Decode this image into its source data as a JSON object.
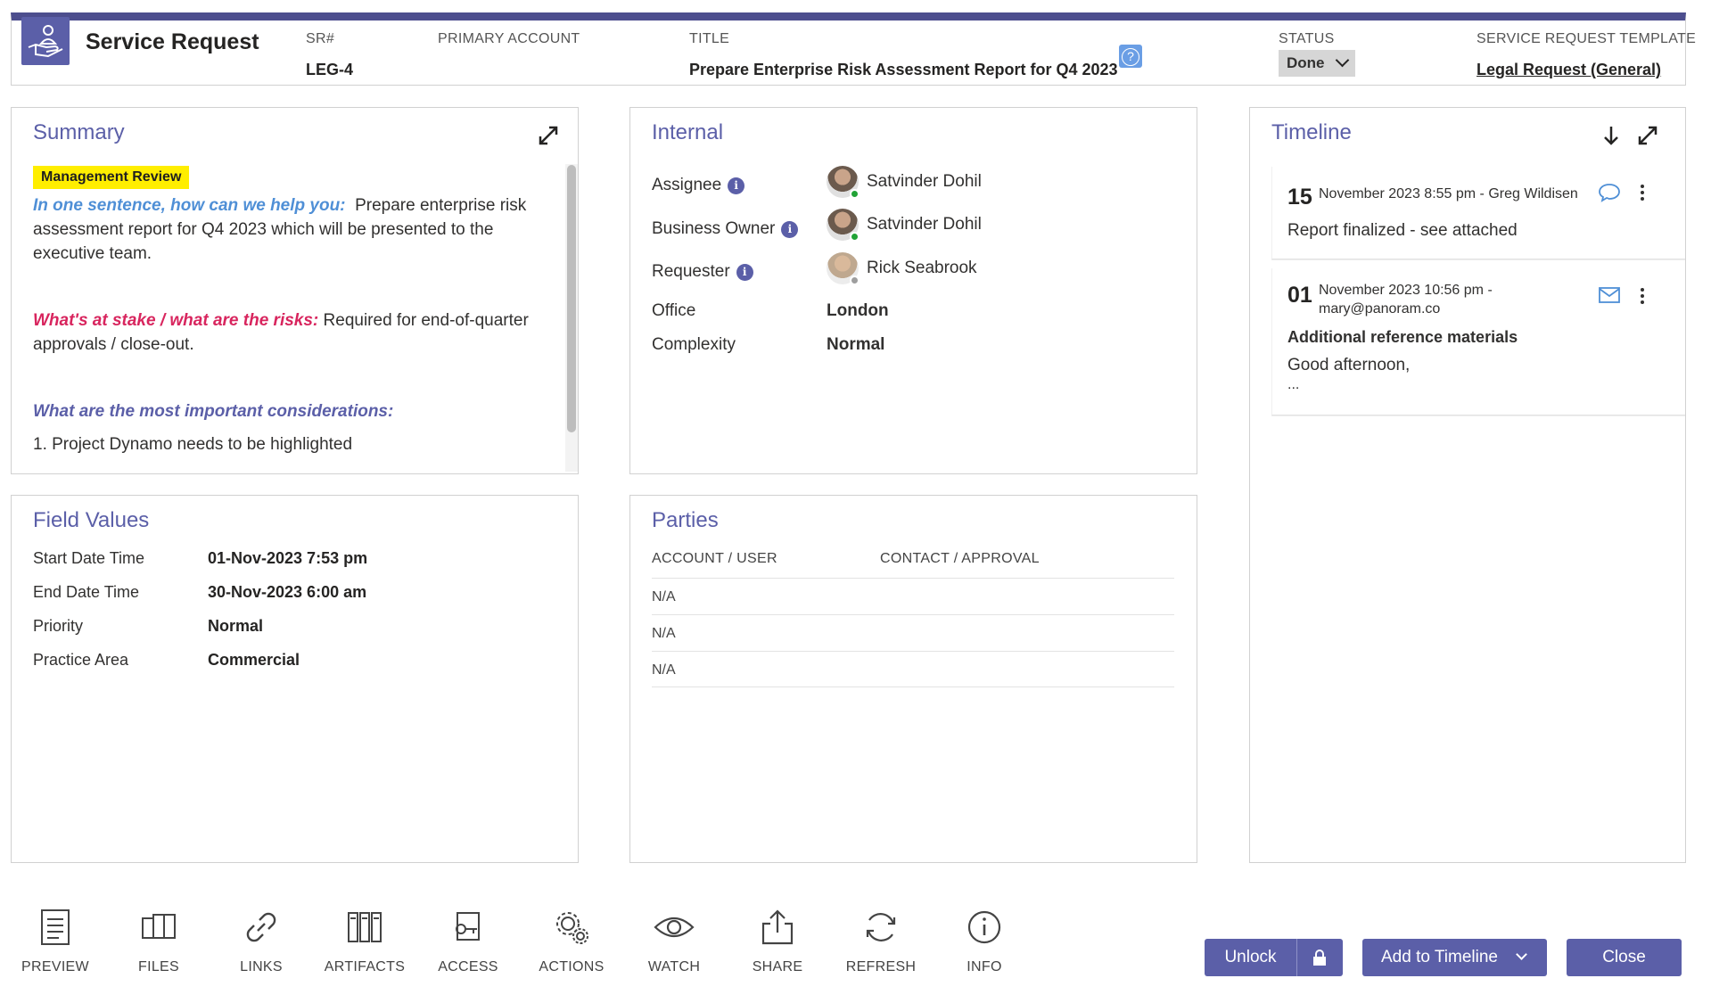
{
  "header": {
    "app_title": "Service Request",
    "sr_label": "SR#",
    "sr_value": "LEG-4",
    "account_label": "PRIMARY ACCOUNT",
    "account_value": "",
    "title_label": "TITLE",
    "title_value": "Prepare Enterprise Risk Assessment Report for Q4 2023",
    "status_label": "STATUS",
    "status_value": "Done",
    "template_label": "SERVICE REQUEST TEMPLATE",
    "template_value": "Legal Request (General)",
    "accent_color": "#4d4e8e"
  },
  "summary": {
    "title": "Summary",
    "badge": "Management Review",
    "q1": "In one sentence, how can we help you:",
    "a1": "Prepare enterprise risk assessment report for Q4 2023 which will be presented to the executive team.",
    "q2": "What's at stake / what are the risks:",
    "a2": "Required for end-of-quarter approvals / close-out.",
    "q3": "What are the most important considerations:",
    "a3": "1. Project Dynamo needs to be highlighted"
  },
  "internal": {
    "title": "Internal",
    "assignee_label": "Assignee",
    "assignee_value": "Satvinder Dohil",
    "owner_label": "Business Owner",
    "owner_value": "Satvinder Dohil",
    "requester_label": "Requester",
    "requester_value": "Rick Seabrook",
    "office_label": "Office",
    "office_value": "London",
    "complexity_label": "Complexity",
    "complexity_value": "Normal"
  },
  "field_values": {
    "title": "Field Values",
    "rows": [
      {
        "label": "Start Date Time",
        "value": "01-Nov-2023 7:53 pm"
      },
      {
        "label": "End Date Time",
        "value": "30-Nov-2023 6:00 am"
      },
      {
        "label": "Priority",
        "value": "Normal"
      },
      {
        "label": "Practice Area",
        "value": "Commercial"
      }
    ]
  },
  "parties": {
    "title": "Parties",
    "col1": "ACCOUNT / USER",
    "col2": "CONTACT / APPROVAL",
    "rows": [
      "N/A",
      "N/A",
      "N/A"
    ]
  },
  "timeline": {
    "title": "Timeline",
    "entries": [
      {
        "day": "15",
        "meta": "November 2023 8:55 pm - Greg Wildisen",
        "meta2": "",
        "heading": "",
        "text": "Report finalized - see attached",
        "more": "",
        "icon": "chat-icon"
      },
      {
        "day": "01",
        "meta": "November 2023 10:56 pm -",
        "meta2": "mary@panoram.co",
        "heading": "Additional reference materials",
        "text": "Good afternoon,",
        "more": "...",
        "icon": "mail-icon"
      }
    ]
  },
  "toolbar": {
    "items": [
      "PREVIEW",
      "FILES",
      "LINKS",
      "ARTIFACTS",
      "ACCESS",
      "ACTIONS",
      "WATCH",
      "SHARE",
      "REFRESH",
      "INFO"
    ],
    "unlock": "Unlock",
    "add_timeline": "Add to Timeline",
    "close": "Close"
  }
}
